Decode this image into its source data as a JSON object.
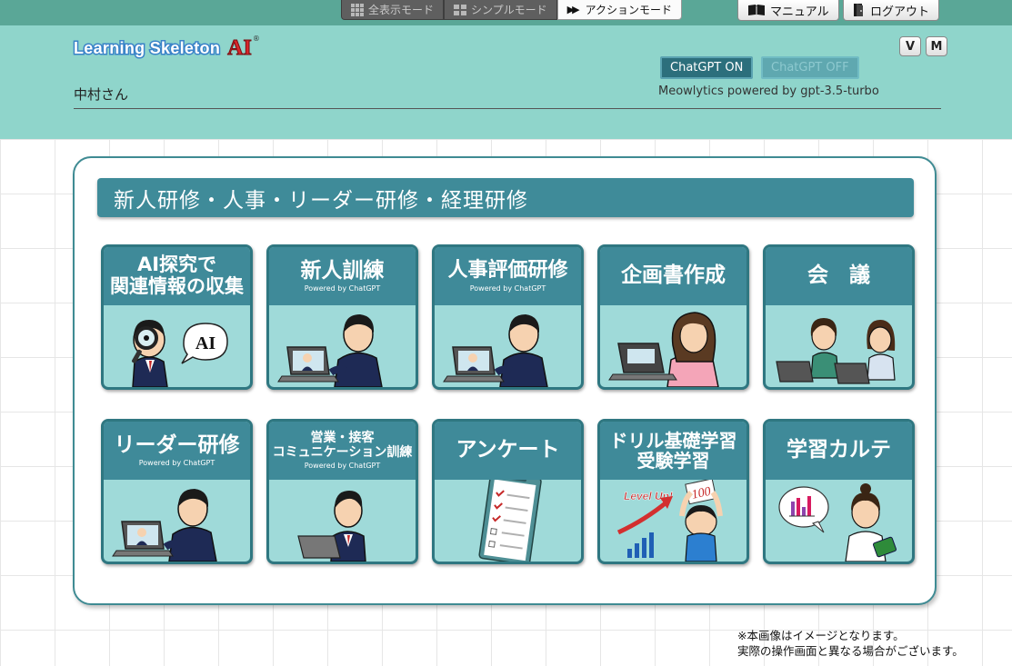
{
  "modes": [
    {
      "label": "全表示モード",
      "icon": "grid-icon",
      "active": false
    },
    {
      "label": "シンプルモード",
      "icon": "grid-icon",
      "active": false
    },
    {
      "label": "アクションモード",
      "icon": "play-icon",
      "active": true
    }
  ],
  "util": {
    "manual": "マニュアル",
    "logout": "ログアウト"
  },
  "logo": {
    "text": "Learning Skeleton",
    "ai": "AI",
    "reg": "®"
  },
  "toggles": {
    "v": "V",
    "m": "M"
  },
  "gpt": {
    "on": "ChatGPT ON",
    "off": "ChatGPT OFF",
    "powered": "Meowlytics powered by gpt-3.5-turbo"
  },
  "user": {
    "name": "中村さん"
  },
  "section": {
    "title": "新人研修・人事・リーダー研修・経理研修"
  },
  "tiles": [
    {
      "title": "AI探究で\n関連情報の収集",
      "sub": "",
      "icon": "magnifier-person-icon"
    },
    {
      "title": "新人訓練",
      "sub": "Powered by ChatGPT",
      "icon": "online-training-icon"
    },
    {
      "title": "人事評価研修",
      "sub": "Powered by ChatGPT",
      "icon": "online-training-icon"
    },
    {
      "title": "企画書作成",
      "sub": "",
      "icon": "laptop-woman-icon"
    },
    {
      "title": "会　議",
      "sub": "",
      "icon": "meeting-icon"
    },
    {
      "title": "リーダー研修",
      "sub": "Powered by ChatGPT",
      "icon": "online-training-icon"
    },
    {
      "title": "営業・接客\nコミュニケーション訓練",
      "sub": "Powered by ChatGPT",
      "icon": "sales-man-icon"
    },
    {
      "title": "アンケート",
      "sub": "",
      "icon": "clipboard-icon"
    },
    {
      "title": "ドリル基礎学習\n受験学習",
      "sub": "",
      "icon": "level-up-icon"
    },
    {
      "title": "学習カルテ",
      "sub": "",
      "icon": "nurse-chart-icon"
    }
  ],
  "art": {
    "ai_bubble": "AI",
    "level_up": "Level Up!",
    "score": "100"
  },
  "note": {
    "line1": "※本画像はイメージとなります。",
    "line2": "実際の操作画面と異なる場合がございます。"
  }
}
